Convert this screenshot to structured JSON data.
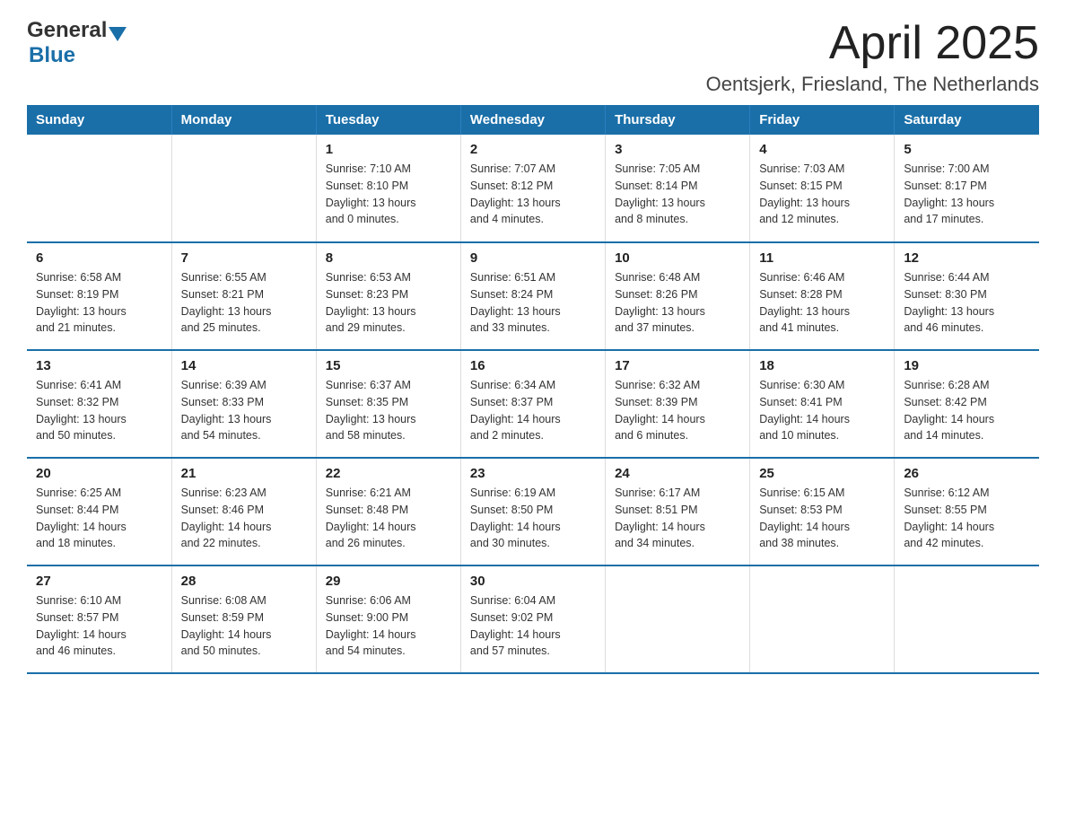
{
  "logo": {
    "general": "General",
    "blue": "Blue",
    "triangle": "▼"
  },
  "title": "April 2025",
  "subtitle": "Oentsjerk, Friesland, The Netherlands",
  "days_header": [
    "Sunday",
    "Monday",
    "Tuesday",
    "Wednesday",
    "Thursday",
    "Friday",
    "Saturday"
  ],
  "weeks": [
    [
      {
        "num": "",
        "info": ""
      },
      {
        "num": "",
        "info": ""
      },
      {
        "num": "1",
        "info": "Sunrise: 7:10 AM\nSunset: 8:10 PM\nDaylight: 13 hours\nand 0 minutes."
      },
      {
        "num": "2",
        "info": "Sunrise: 7:07 AM\nSunset: 8:12 PM\nDaylight: 13 hours\nand 4 minutes."
      },
      {
        "num": "3",
        "info": "Sunrise: 7:05 AM\nSunset: 8:14 PM\nDaylight: 13 hours\nand 8 minutes."
      },
      {
        "num": "4",
        "info": "Sunrise: 7:03 AM\nSunset: 8:15 PM\nDaylight: 13 hours\nand 12 minutes."
      },
      {
        "num": "5",
        "info": "Sunrise: 7:00 AM\nSunset: 8:17 PM\nDaylight: 13 hours\nand 17 minutes."
      }
    ],
    [
      {
        "num": "6",
        "info": "Sunrise: 6:58 AM\nSunset: 8:19 PM\nDaylight: 13 hours\nand 21 minutes."
      },
      {
        "num": "7",
        "info": "Sunrise: 6:55 AM\nSunset: 8:21 PM\nDaylight: 13 hours\nand 25 minutes."
      },
      {
        "num": "8",
        "info": "Sunrise: 6:53 AM\nSunset: 8:23 PM\nDaylight: 13 hours\nand 29 minutes."
      },
      {
        "num": "9",
        "info": "Sunrise: 6:51 AM\nSunset: 8:24 PM\nDaylight: 13 hours\nand 33 minutes."
      },
      {
        "num": "10",
        "info": "Sunrise: 6:48 AM\nSunset: 8:26 PM\nDaylight: 13 hours\nand 37 minutes."
      },
      {
        "num": "11",
        "info": "Sunrise: 6:46 AM\nSunset: 8:28 PM\nDaylight: 13 hours\nand 41 minutes."
      },
      {
        "num": "12",
        "info": "Sunrise: 6:44 AM\nSunset: 8:30 PM\nDaylight: 13 hours\nand 46 minutes."
      }
    ],
    [
      {
        "num": "13",
        "info": "Sunrise: 6:41 AM\nSunset: 8:32 PM\nDaylight: 13 hours\nand 50 minutes."
      },
      {
        "num": "14",
        "info": "Sunrise: 6:39 AM\nSunset: 8:33 PM\nDaylight: 13 hours\nand 54 minutes."
      },
      {
        "num": "15",
        "info": "Sunrise: 6:37 AM\nSunset: 8:35 PM\nDaylight: 13 hours\nand 58 minutes."
      },
      {
        "num": "16",
        "info": "Sunrise: 6:34 AM\nSunset: 8:37 PM\nDaylight: 14 hours\nand 2 minutes."
      },
      {
        "num": "17",
        "info": "Sunrise: 6:32 AM\nSunset: 8:39 PM\nDaylight: 14 hours\nand 6 minutes."
      },
      {
        "num": "18",
        "info": "Sunrise: 6:30 AM\nSunset: 8:41 PM\nDaylight: 14 hours\nand 10 minutes."
      },
      {
        "num": "19",
        "info": "Sunrise: 6:28 AM\nSunset: 8:42 PM\nDaylight: 14 hours\nand 14 minutes."
      }
    ],
    [
      {
        "num": "20",
        "info": "Sunrise: 6:25 AM\nSunset: 8:44 PM\nDaylight: 14 hours\nand 18 minutes."
      },
      {
        "num": "21",
        "info": "Sunrise: 6:23 AM\nSunset: 8:46 PM\nDaylight: 14 hours\nand 22 minutes."
      },
      {
        "num": "22",
        "info": "Sunrise: 6:21 AM\nSunset: 8:48 PM\nDaylight: 14 hours\nand 26 minutes."
      },
      {
        "num": "23",
        "info": "Sunrise: 6:19 AM\nSunset: 8:50 PM\nDaylight: 14 hours\nand 30 minutes."
      },
      {
        "num": "24",
        "info": "Sunrise: 6:17 AM\nSunset: 8:51 PM\nDaylight: 14 hours\nand 34 minutes."
      },
      {
        "num": "25",
        "info": "Sunrise: 6:15 AM\nSunset: 8:53 PM\nDaylight: 14 hours\nand 38 minutes."
      },
      {
        "num": "26",
        "info": "Sunrise: 6:12 AM\nSunset: 8:55 PM\nDaylight: 14 hours\nand 42 minutes."
      }
    ],
    [
      {
        "num": "27",
        "info": "Sunrise: 6:10 AM\nSunset: 8:57 PM\nDaylight: 14 hours\nand 46 minutes."
      },
      {
        "num": "28",
        "info": "Sunrise: 6:08 AM\nSunset: 8:59 PM\nDaylight: 14 hours\nand 50 minutes."
      },
      {
        "num": "29",
        "info": "Sunrise: 6:06 AM\nSunset: 9:00 PM\nDaylight: 14 hours\nand 54 minutes."
      },
      {
        "num": "30",
        "info": "Sunrise: 6:04 AM\nSunset: 9:02 PM\nDaylight: 14 hours\nand 57 minutes."
      },
      {
        "num": "",
        "info": ""
      },
      {
        "num": "",
        "info": ""
      },
      {
        "num": "",
        "info": ""
      }
    ]
  ]
}
